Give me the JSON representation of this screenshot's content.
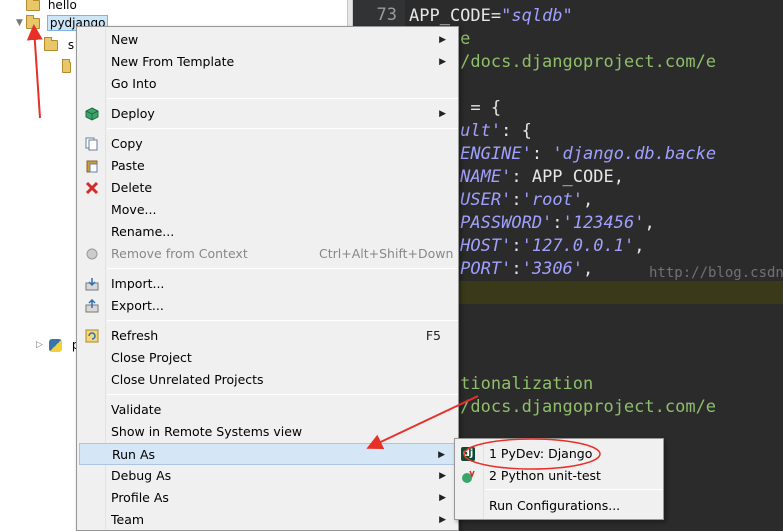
{
  "explorer": {
    "items": [
      {
        "label": "hello"
      },
      {
        "label": "pydjango"
      },
      {
        "label": "s"
      },
      {
        "label": "p"
      }
    ]
  },
  "editor": {
    "line_number": "73",
    "lines": [
      {
        "segments": [
          {
            "t": "APP_CODE=",
            "c": "plain"
          },
          {
            "t": "\"sqldb\"",
            "c": "str"
          }
        ]
      },
      {
        "segments": [
          {
            "t": "tabase",
            "c": "comment"
          }
        ]
      },
      {
        "segments": [
          {
            "t": "tps://docs.djangoproject.com/e",
            "c": "comment"
          }
        ]
      },
      {
        "segments": [
          {
            "t": "",
            "c": "plain"
          }
        ]
      },
      {
        "segments": [
          {
            "t": "BASES = {",
            "c": "plain"
          }
        ]
      },
      {
        "segments": [
          {
            "t": "'default'",
            "c": "str"
          },
          {
            "t": ": {",
            "c": "plain"
          }
        ]
      },
      {
        "segments": [
          {
            "t": "    'ENGINE'",
            "c": "str"
          },
          {
            "t": ": ",
            "c": "plain"
          },
          {
            "t": "'django.db.backe",
            "c": "str"
          }
        ]
      },
      {
        "segments": [
          {
            "t": "    'NAME'",
            "c": "str"
          },
          {
            "t": ": APP_CODE,",
            "c": "plain"
          }
        ]
      },
      {
        "segments": [
          {
            "t": "    'USER'",
            "c": "str"
          },
          {
            "t": ":",
            "c": "plain"
          },
          {
            "t": "'root'",
            "c": "str"
          },
          {
            "t": ",",
            "c": "plain"
          }
        ]
      },
      {
        "segments": [
          {
            "t": "    'PASSWORD'",
            "c": "str"
          },
          {
            "t": ":",
            "c": "plain"
          },
          {
            "t": "'123456'",
            "c": "str"
          },
          {
            "t": ",",
            "c": "plain"
          }
        ]
      },
      {
        "segments": [
          {
            "t": "    'HOST'",
            "c": "str"
          },
          {
            "t": ":",
            "c": "plain"
          },
          {
            "t": "'127.0.0.1'",
            "c": "str"
          },
          {
            "t": ",",
            "c": "plain"
          }
        ]
      },
      {
        "segments": [
          {
            "t": "    'PORT'",
            "c": "str"
          },
          {
            "t": ":",
            "c": "plain"
          },
          {
            "t": "'3306'",
            "c": "str"
          },
          {
            "t": ",",
            "c": "plain"
          }
        ]
      },
      {
        "segments": [
          {
            "t": "",
            "c": "plain"
          }
        ]
      },
      {
        "segments": [
          {
            "t": "",
            "c": "plain"
          }
        ]
      },
      {
        "segments": [
          {
            "t": "",
            "c": "plain"
          }
        ]
      },
      {
        "segments": [
          {
            "t": "",
            "c": "plain"
          }
        ]
      },
      {
        "segments": [
          {
            "t": "ternationalization",
            "c": "comment"
          }
        ]
      },
      {
        "segments": [
          {
            "t": "tps://docs.djangoproject.com/e",
            "c": "comment"
          }
        ]
      }
    ],
    "watermark": "http://blog.csdn.net/"
  },
  "menu": {
    "items": [
      {
        "label": "New",
        "submenu": true
      },
      {
        "label": "New From Template",
        "submenu": true
      },
      {
        "label": "Go Into"
      },
      {
        "sep": true
      },
      {
        "label": "Deploy",
        "submenu": true,
        "icon": "deploy-icon"
      },
      {
        "sep": true
      },
      {
        "label": "Copy",
        "icon": "copy-icon"
      },
      {
        "label": "Paste",
        "icon": "paste-icon"
      },
      {
        "label": "Delete",
        "icon": "delete-icon"
      },
      {
        "label": "Move..."
      },
      {
        "label": "Rename..."
      },
      {
        "label": "Remove from Context",
        "shortcut": "Ctrl+Alt+Shift+Down",
        "disabled": true,
        "icon": "remove-context-icon"
      },
      {
        "sep": true
      },
      {
        "label": "Import...",
        "icon": "import-icon"
      },
      {
        "label": "Export...",
        "icon": "export-icon"
      },
      {
        "sep": true
      },
      {
        "label": "Refresh",
        "shortcut": "F5",
        "icon": "refresh-icon"
      },
      {
        "label": "Close Project"
      },
      {
        "label": "Close Unrelated Projects"
      },
      {
        "sep": true
      },
      {
        "label": "Validate"
      },
      {
        "label": "Show in Remote Systems view"
      },
      {
        "label": "Run As",
        "submenu": true,
        "hover": true
      },
      {
        "label": "Debug As",
        "submenu": true
      },
      {
        "label": "Profile As",
        "submenu": true
      },
      {
        "label": "Team",
        "submenu": true
      }
    ]
  },
  "submenu": {
    "items": [
      {
        "label": "1 PyDev: Django",
        "icon": "django-icon"
      },
      {
        "label": "2 Python unit-test",
        "icon": "python-unittest-icon"
      },
      {
        "sep": true
      },
      {
        "label": "Run Configurations..."
      }
    ]
  },
  "colors": {
    "editor_bg": "#2b2b2b",
    "menu_bg": "#f0f0f0",
    "hover_bg": "#d5e6f7",
    "annotation_red": "#e8302a"
  }
}
